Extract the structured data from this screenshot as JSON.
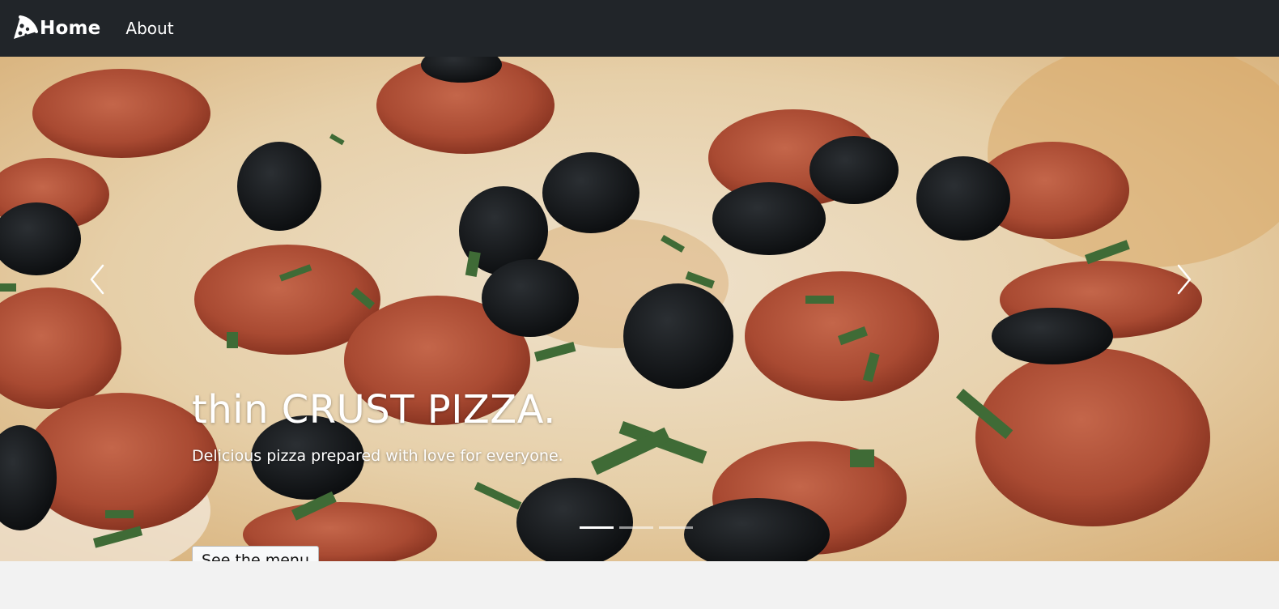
{
  "navbar": {
    "brand_label": "Home",
    "links": [
      {
        "label": "About"
      }
    ],
    "background": "#212529"
  },
  "carousel": {
    "slide": {
      "title": "thin CRUST PIZZA.",
      "text": "Delicious pizza prepared with love for everyone.",
      "button_label": "See the menu"
    },
    "slide_count": 3,
    "active_index": 0,
    "controls": {
      "prev_icon": "chevron-left-icon",
      "next_icon": "chevron-right-icon"
    }
  },
  "icons": {
    "brand": "pizza-slice-icon"
  }
}
